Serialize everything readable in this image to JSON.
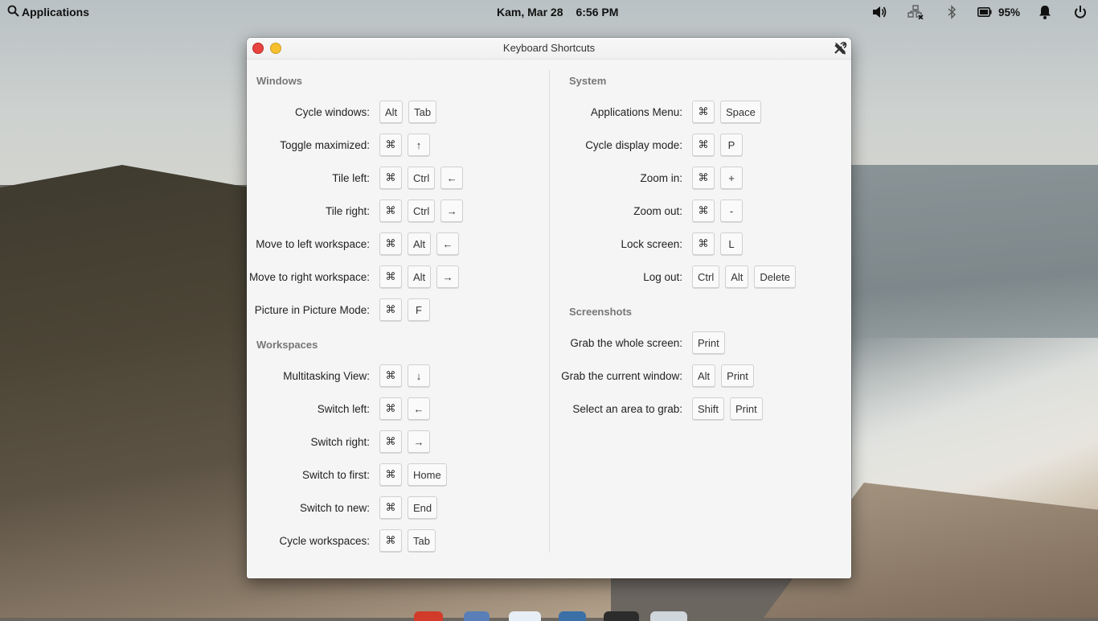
{
  "panel": {
    "applications_label": "Applications",
    "date": "Kam, Mar 28",
    "time": "6:56 PM",
    "battery_percent": "95%",
    "icons": [
      "search-icon",
      "volume-icon",
      "network-disconnected-icon",
      "bluetooth-icon",
      "battery-icon",
      "notification-bell-icon",
      "power-icon"
    ]
  },
  "window": {
    "title": "Keyboard Shortcuts",
    "left": {
      "sections": [
        {
          "title": "Windows",
          "rows": [
            {
              "label": "Cycle windows:",
              "keys": [
                "Alt",
                "Tab"
              ]
            },
            {
              "label": "Toggle maximized:",
              "keys": [
                "⌘",
                "↑"
              ]
            },
            {
              "label": "Tile left:",
              "keys": [
                "⌘",
                "Ctrl",
                "←"
              ]
            },
            {
              "label": "Tile right:",
              "keys": [
                "⌘",
                "Ctrl",
                "→"
              ]
            },
            {
              "label": "Move to left workspace:",
              "keys": [
                "⌘",
                "Alt",
                "←"
              ]
            },
            {
              "label": "Move to right workspace:",
              "keys": [
                "⌘",
                "Alt",
                "→"
              ]
            },
            {
              "label": "Picture in Picture Mode:",
              "keys": [
                "⌘",
                "F"
              ]
            }
          ]
        },
        {
          "title": "Workspaces",
          "rows": [
            {
              "label": "Multitasking View:",
              "keys": [
                "⌘",
                "↓"
              ]
            },
            {
              "label": "Switch left:",
              "keys": [
                "⌘",
                "←"
              ]
            },
            {
              "label": "Switch right:",
              "keys": [
                "⌘",
                "→"
              ]
            },
            {
              "label": "Switch to first:",
              "keys": [
                "⌘",
                "Home"
              ]
            },
            {
              "label": "Switch to new:",
              "keys": [
                "⌘",
                "End"
              ]
            },
            {
              "label": "Cycle workspaces:",
              "keys": [
                "⌘",
                "Tab"
              ]
            }
          ]
        }
      ]
    },
    "right": {
      "sections": [
        {
          "title": "System",
          "rows": [
            {
              "label": "Applications Menu:",
              "keys": [
                "⌘",
                "Space"
              ]
            },
            {
              "label": "Cycle display mode:",
              "keys": [
                "⌘",
                "P"
              ]
            },
            {
              "label": "Zoom in:",
              "keys": [
                "⌘",
                "+"
              ]
            },
            {
              "label": "Zoom out:",
              "keys": [
                "⌘",
                "-"
              ]
            },
            {
              "label": "Lock screen:",
              "keys": [
                "⌘",
                "L"
              ]
            },
            {
              "label": "Log out:",
              "keys": [
                "Ctrl",
                "Alt",
                "Delete"
              ]
            }
          ]
        },
        {
          "title": "Screenshots",
          "rows": [
            {
              "label": "Grab the whole screen:",
              "keys": [
                "Print"
              ]
            },
            {
              "label": "Grab the current window:",
              "keys": [
                "Alt",
                "Print"
              ]
            },
            {
              "label": "Select an area to grab:",
              "keys": [
                "Shift",
                "Print"
              ]
            }
          ]
        }
      ]
    }
  }
}
